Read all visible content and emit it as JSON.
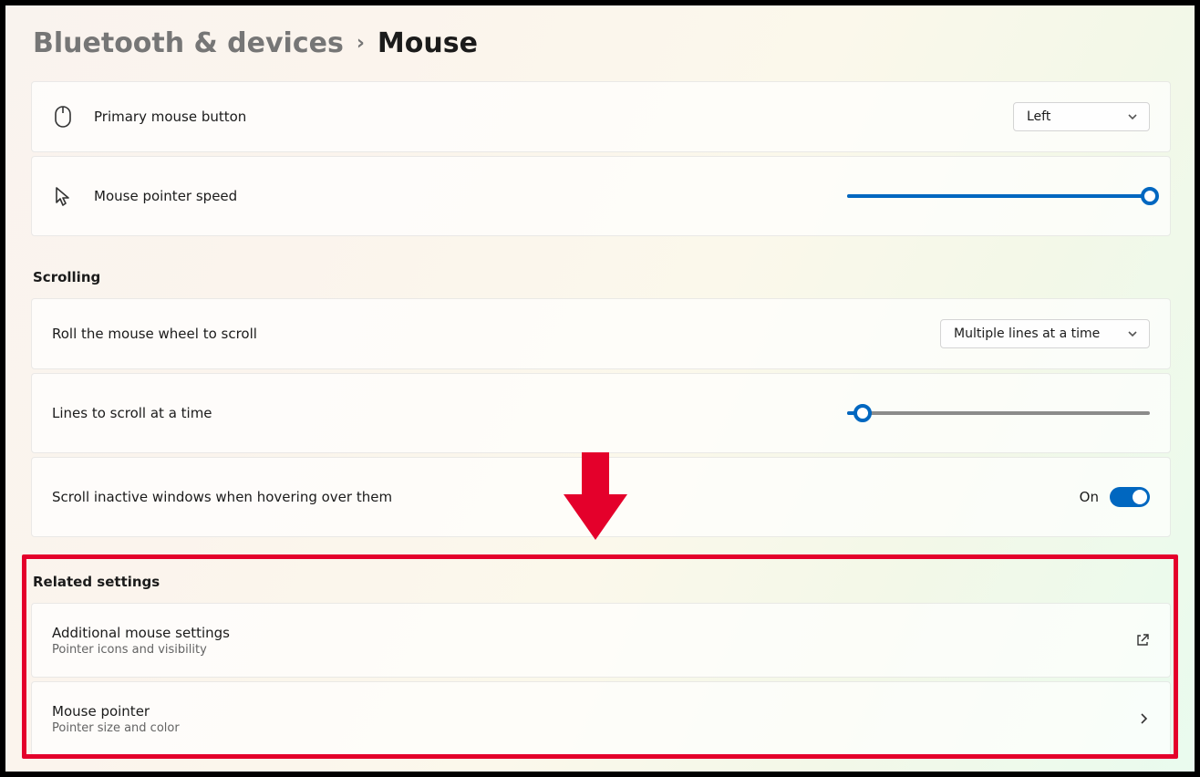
{
  "breadcrumb": {
    "parent": "Bluetooth & devices",
    "current": "Mouse"
  },
  "settings": {
    "primary_button": {
      "label": "Primary mouse button",
      "value": "Left"
    },
    "pointer_speed": {
      "label": "Mouse pointer speed",
      "value_percent": 100
    }
  },
  "scrolling": {
    "header": "Scrolling",
    "wheel_mode": {
      "label": "Roll the mouse wheel to scroll",
      "value": "Multiple lines at a time"
    },
    "lines_at_a_time": {
      "label": "Lines to scroll at a time",
      "value_percent": 5
    },
    "scroll_inactive": {
      "label": "Scroll inactive windows when hovering over them",
      "state_text": "On",
      "on": true
    }
  },
  "related": {
    "header": "Related settings",
    "items": [
      {
        "title": "Additional mouse settings",
        "desc": "Pointer icons and visibility",
        "action": "external"
      },
      {
        "title": "Mouse pointer",
        "desc": "Pointer size and color",
        "action": "navigate"
      }
    ]
  }
}
